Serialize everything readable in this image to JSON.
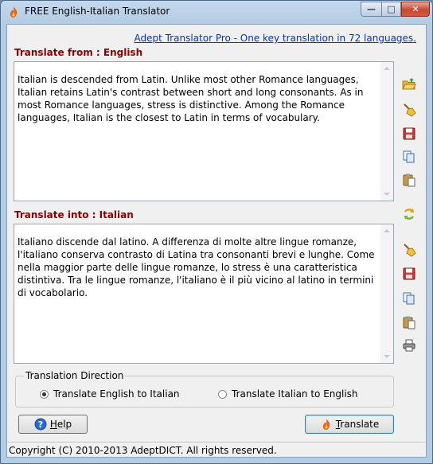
{
  "window": {
    "title": "FREE English-Italian Translator",
    "controls": {
      "minimize": "—",
      "maximize": "□",
      "close": "✕"
    }
  },
  "promo_link": "Adept Translator Pro - One key translation in 72 languages.",
  "source": {
    "label": "Translate from : English",
    "text": "Italian is descended from Latin. Unlike most other Romance languages, Italian retains Latin's contrast between short and long consonants. As in most Romance languages, stress is distinctive. Among the Romance languages, Italian is the closest to Latin in terms of vocabulary."
  },
  "target": {
    "label": "Translate into : Italian",
    "text": "Italiano discende dal latino. A differenza di molte altre lingue romanze, l'italiano conserva contrasto di Latina tra consonanti brevi e lunghe. Come nella maggior parte delle lingue romanze, lo stress è una caratteristica distintiva. Tra le lingue romanze, l'italiano è il più vicino al latino in termini di vocabolario."
  },
  "toolbar_top": [
    "open-folder-icon",
    "broom-clear-icon",
    "save-disk-icon",
    "copy-icon",
    "paste-icon"
  ],
  "swap_icon": "swap-arrows-icon",
  "toolbar_bottom": [
    "broom-clear-icon",
    "save-disk-icon",
    "copy-icon",
    "paste-icon",
    "printer-icon"
  ],
  "direction": {
    "caption": "Translation Direction",
    "options": [
      {
        "label": "Translate English to Italian",
        "selected": true
      },
      {
        "label": "Translate Italian to English",
        "selected": false
      }
    ]
  },
  "buttons": {
    "help": {
      "underline": "H",
      "rest": "elp"
    },
    "translate": {
      "underline": "T",
      "rest": "ranslate"
    }
  },
  "status": "Copyright (C) 2010-2013 AdeptDICT. All rights reserved.",
  "colors": {
    "section_label": "#8b0000",
    "link": "#0033cc",
    "close_button": "#c44a33"
  }
}
